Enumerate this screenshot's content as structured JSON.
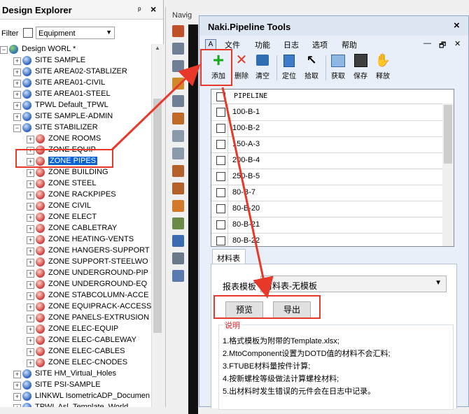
{
  "explorer": {
    "title": "Design Explorer",
    "pin_icon": "pin-icon",
    "close_icon": "close-icon",
    "filter_label": "Filter",
    "filter_value": "Equipment",
    "tree": [
      {
        "label": "Design WORL *",
        "icon": "world-icon"
      },
      {
        "label": "SITE SAMPLE",
        "icon": "site-icon"
      },
      {
        "label": "SITE AREA02-STABLIZER",
        "icon": "site-icon"
      },
      {
        "label": "SITE AREA01-CIVIL",
        "icon": "site-icon"
      },
      {
        "label": "SITE AREA01-STEEL",
        "icon": "site-icon"
      },
      {
        "label": "TPWL Default_TPWL",
        "icon": "site-icon"
      },
      {
        "label": "SITE SAMPLE-ADMIN",
        "icon": "site-icon"
      },
      {
        "label": "SITE STABILIZER",
        "icon": "site-icon"
      },
      {
        "label": "ZONE ROOMS",
        "icon": "zone-icon"
      },
      {
        "label": "ZONE EQUIP",
        "icon": "zone-icon"
      },
      {
        "label": "ZONE PIPES",
        "icon": "zone-icon",
        "selected": true
      },
      {
        "label": "ZONE BUILDING",
        "icon": "zone-icon"
      },
      {
        "label": "ZONE STEEL",
        "icon": "zone-icon"
      },
      {
        "label": "ZONE RACKPIPES",
        "icon": "zone-icon"
      },
      {
        "label": "ZONE CIVIL",
        "icon": "zone-icon"
      },
      {
        "label": "ZONE ELECT",
        "icon": "zone-icon"
      },
      {
        "label": "ZONE CABLETRAY",
        "icon": "zone-icon"
      },
      {
        "label": "ZONE HEATING-VENTS",
        "icon": "zone-icon"
      },
      {
        "label": "ZONE HANGERS-SUPPORT",
        "icon": "zone-icon"
      },
      {
        "label": "ZONE SUPPORT-STEELWO",
        "icon": "zone-icon"
      },
      {
        "label": "ZONE UNDERGROUND-PIP",
        "icon": "zone-icon"
      },
      {
        "label": "ZONE UNDERGROUND-EQ",
        "icon": "zone-icon"
      },
      {
        "label": "ZONE STABCOLUMN-ACCE",
        "icon": "zone-icon"
      },
      {
        "label": "ZONE EQUIPRACK-ACCESS",
        "icon": "zone-icon"
      },
      {
        "label": "ZONE PANELS-EXTRUSION",
        "icon": "zone-icon"
      },
      {
        "label": "ZONE ELEC-EQUIP",
        "icon": "zone-icon"
      },
      {
        "label": "ZONE ELEC-CABLEWAY",
        "icon": "zone-icon"
      },
      {
        "label": "ZONE ELEC-CABLES",
        "icon": "zone-icon"
      },
      {
        "label": "ZONE ELEC-CNODES",
        "icon": "zone-icon"
      },
      {
        "label": "SITE HM_Virtual_Holes",
        "icon": "site-icon"
      },
      {
        "label": "SITE PSI-SAMPLE",
        "icon": "site-icon"
      },
      {
        "label": "LINKWL IsometricADP_Documen",
        "icon": "site-icon"
      },
      {
        "label": "TPWL Asl_Template_World",
        "icon": "site-icon"
      }
    ]
  },
  "navigator": {
    "title": "Navig",
    "tools": [
      "navigate-icon",
      "zoom-icon",
      "zoom-out-icon",
      "orbit-icon",
      "zoom-in-icon",
      "refresh-icon",
      "move-icon",
      "walk-icon",
      "look-icon",
      "center-icon",
      "section-icon",
      "update-icon",
      "axes-icon",
      "clip-icon",
      "window-icon"
    ]
  },
  "naki": {
    "title": "Naki.Pipeline Tools",
    "close_icon": "close-icon",
    "menu": [
      "文件",
      "功能",
      "日志",
      "选项",
      "帮助"
    ],
    "window_controls": [
      "—",
      "🗗",
      "✕"
    ],
    "toolbar": {
      "add": "添加",
      "delete": "删除",
      "clear": "清空",
      "locate": "定位",
      "pick": "拾取",
      "get": "获取",
      "save": "保存",
      "release": "释放"
    },
    "grid": {
      "header": "PIPELINE",
      "rows": [
        "100-B-1",
        "100-B-2",
        "150-A-3",
        "200-B-4",
        "250-B-5",
        "80-B-7",
        "80-B-20",
        "80-B-21",
        "80-B-22"
      ]
    },
    "tab_label": "材料表",
    "report_label": "报表模板",
    "report_value": "材料表-无模板",
    "preview_button": "预览",
    "export_button": "导出",
    "notes_title": "说明",
    "notes": [
      "1.格式模板为附带的Template.xlsx;",
      "2.MtoComponent设置为DOTD值的材料不会汇料;",
      "3.FTUBE材料量按件计算;",
      "4.按新螺栓等级做法计算螺栓材料;",
      "5.出材料时发生错误的元件会在日志中记录。"
    ]
  },
  "colors": {
    "selection": "#0a64d8",
    "annotation": "#e8382a",
    "window_bg": "#e9eff8",
    "notes_title": "#e01e1e"
  }
}
